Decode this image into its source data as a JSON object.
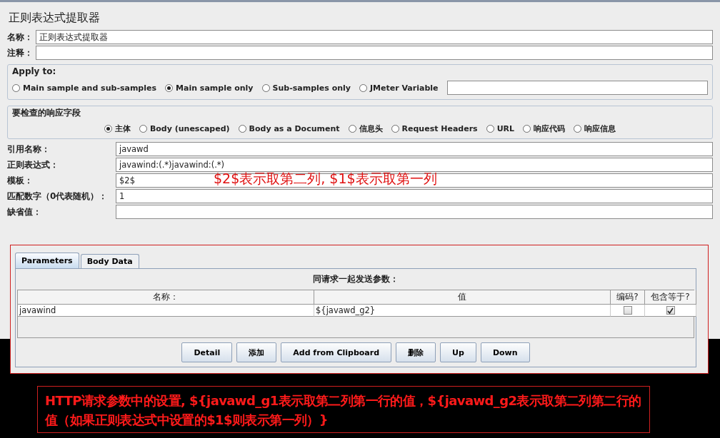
{
  "title": "正则表达式提取器",
  "name_field": {
    "label": "名称：",
    "value": "正则表达式提取器"
  },
  "comment_field": {
    "label": "注释："
  },
  "apply_to": {
    "legend": "Apply to:",
    "options": [
      {
        "label": "Main sample and sub-samples",
        "selected": false
      },
      {
        "label": "Main sample only",
        "selected": true
      },
      {
        "label": "Sub-samples only",
        "selected": false
      },
      {
        "label": "JMeter Variable",
        "selected": false
      }
    ]
  },
  "response_field": {
    "legend": "要检查的响应字段",
    "options": [
      {
        "label": "主体",
        "selected": true
      },
      {
        "label": "Body (unescaped)",
        "selected": false
      },
      {
        "label": "Body as a Document",
        "selected": false
      },
      {
        "label": "信息头",
        "selected": false
      },
      {
        "label": "Request Headers",
        "selected": false
      },
      {
        "label": "URL",
        "selected": false
      },
      {
        "label": "响应代码",
        "selected": false
      },
      {
        "label": "响应信息",
        "selected": false
      }
    ]
  },
  "fields": [
    {
      "label": "引用名称：",
      "value": "javawd"
    },
    {
      "label": "正则表达式：",
      "value": "javawind:(.*)javawind:(.*)"
    },
    {
      "label": "模板：",
      "value": "$2$",
      "annotation": "$2$表示取第二列, $1$表示取第一列"
    },
    {
      "label": "匹配数字（0代表随机）：",
      "value": "1"
    },
    {
      "label": "缺省值："
    }
  ],
  "tabs": [
    {
      "label": "Parameters",
      "selected": true
    },
    {
      "label": "Body Data",
      "selected": false
    }
  ],
  "table": {
    "title": "同请求一起发送参数：",
    "columns": [
      "名称：",
      "值",
      "编码?",
      "包含等于?"
    ],
    "rows": [
      {
        "name": "javawind",
        "value": "${javawd_g2}",
        "encode": false,
        "include_equals": true
      }
    ]
  },
  "buttons": [
    "Detail",
    "添加",
    "Add from Clipboard",
    "删除",
    "Up",
    "Down"
  ],
  "caption": "HTTP请求参数中的设置, ${javawd_g1表示取第二列第一行的值，${javawd_g2表示取第二列第二行的值（如果正则表达式中设置的$1$则表示第一列）}"
}
